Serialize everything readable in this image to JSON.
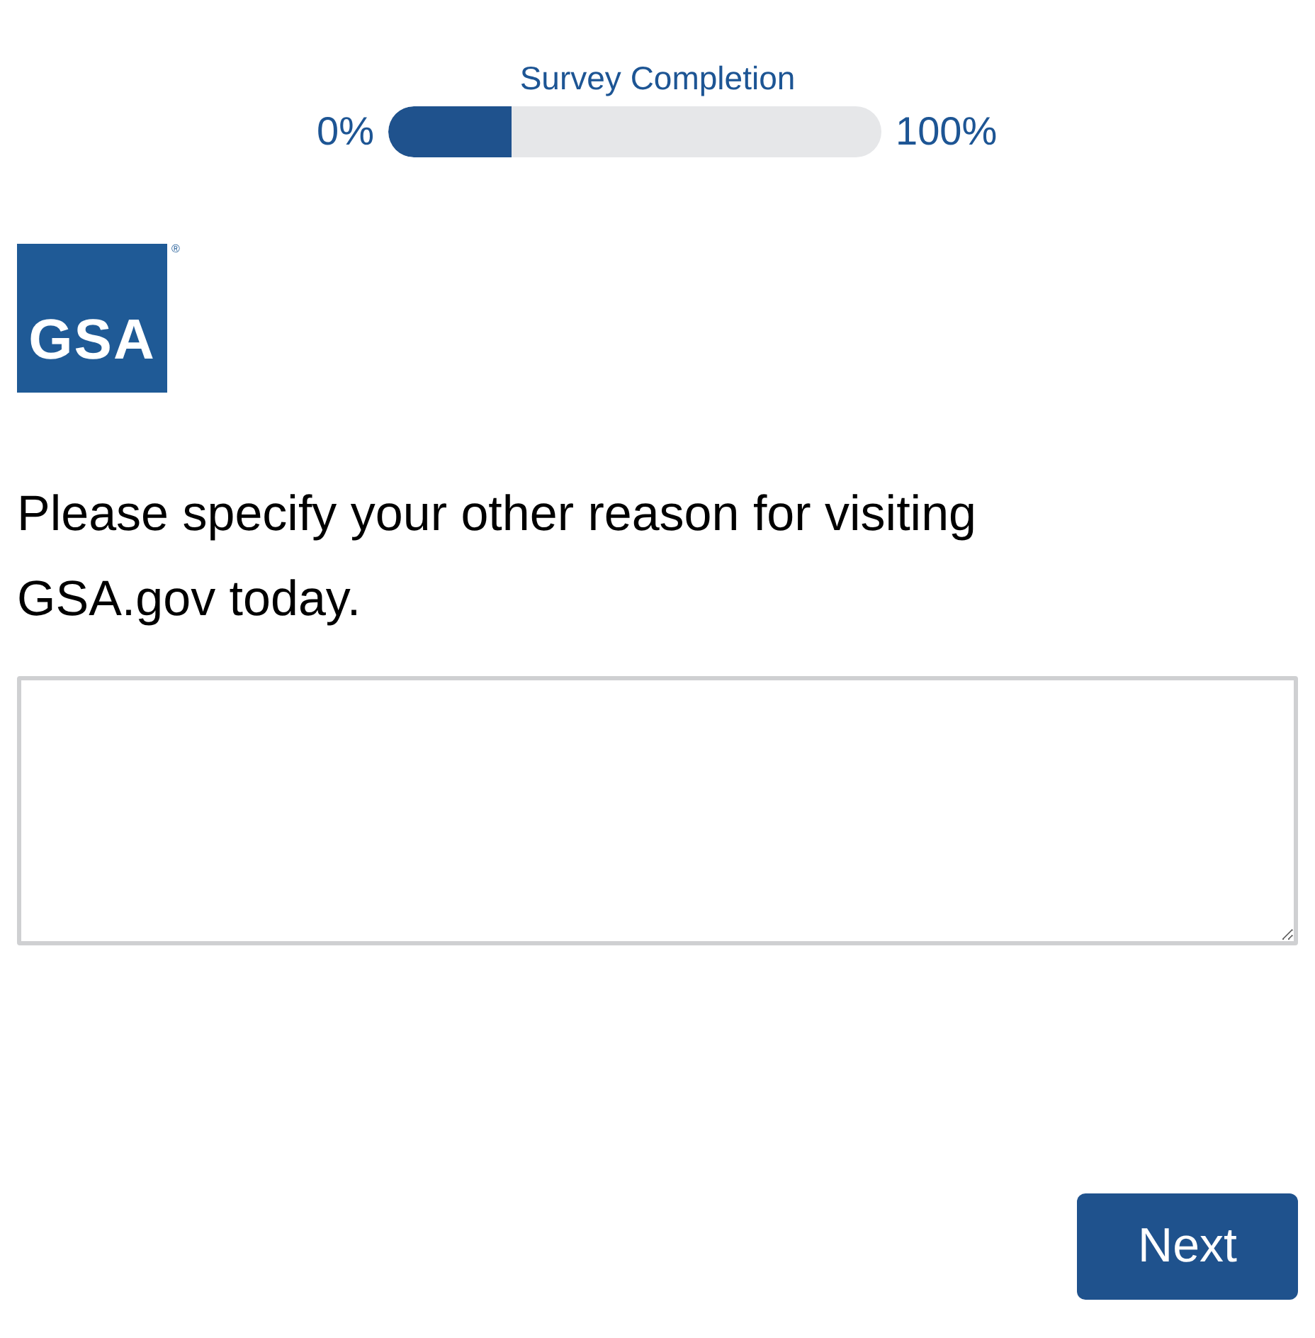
{
  "progress": {
    "title": "Survey Completion",
    "min_label": "0%",
    "max_label": "100%",
    "level": 0.25
  },
  "logo": {
    "text": "GSA",
    "mark": "®"
  },
  "question": "Please specify your other reason for visiting GSA.gov today.",
  "buttons": [
    "Next"
  ]
}
